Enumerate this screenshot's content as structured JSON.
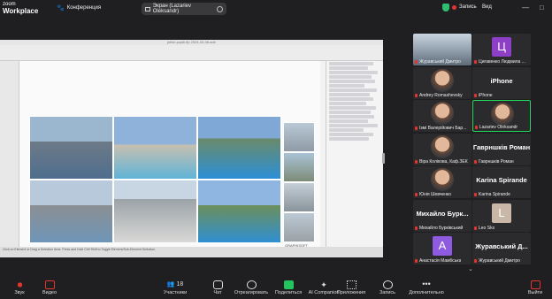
{
  "app": {
    "logo_line1": "zoom",
    "logo_line2": "Workplace"
  },
  "header": {
    "meeting_label": "Конференция",
    "share_pill": "Экран (Lazariev Oleksandr)",
    "recording_label": "Запись",
    "view_label": "Вид"
  },
  "shared_window": {
    "title": "jnflsh.pzplb.flp 2024-03-08.ade",
    "statusbar": "Click on Element or Drag a Selection Area. Press and Hold Ctrl+Shift to Toggle Element/Sub-Element Selection.",
    "footer_tag": "GRAPHISOFT"
  },
  "participants": [
    {
      "name": "Журавський Дмитро",
      "type": "photo"
    },
    {
      "name": "Цигавенко Людмила ...",
      "type": "avatar",
      "letter": "Ц",
      "color": "#8d3fc7"
    },
    {
      "name": "Andrey Romashevsky",
      "type": "face"
    },
    {
      "name": "iPhone",
      "type": "text",
      "big": "iPhone"
    },
    {
      "name": "Ізмі Валерійович Бар...",
      "type": "face"
    },
    {
      "name": "Lazariev Oleksandr",
      "type": "face",
      "active": true
    },
    {
      "name": "Віра Колікова, Каф.ЗЕК",
      "type": "face"
    },
    {
      "name": "Гаврншків Роман",
      "type": "text",
      "big": "Гаврншків Роман"
    },
    {
      "name": "Юнія Шевченко",
      "type": "face"
    },
    {
      "name": "Karina Spirande",
      "type": "text",
      "big": "Karina Spirande"
    },
    {
      "name": "Михайло Бурківський",
      "type": "text",
      "big": "Михайло Бурк..."
    },
    {
      "name": "Leo Sko",
      "type": "avatar",
      "letter": "L",
      "color": "#c9b8a8"
    },
    {
      "name": "Анастасія Мамбська",
      "type": "avatar",
      "letter": "A",
      "color": "#8e5be0"
    },
    {
      "name": "Журавський Дмитро",
      "type": "text",
      "big": "Журавський Д..."
    }
  ],
  "toolbar": {
    "audio": "Звук",
    "video": "Видео",
    "participants": "Участники",
    "participants_count": "18",
    "chat": "Чат",
    "react": "Отреагировать",
    "share": "Поделиться",
    "ai": "AI Companion",
    "apps": "Приложения",
    "record": "Запись",
    "more": "Дополнительно",
    "leave": "Выйти"
  }
}
